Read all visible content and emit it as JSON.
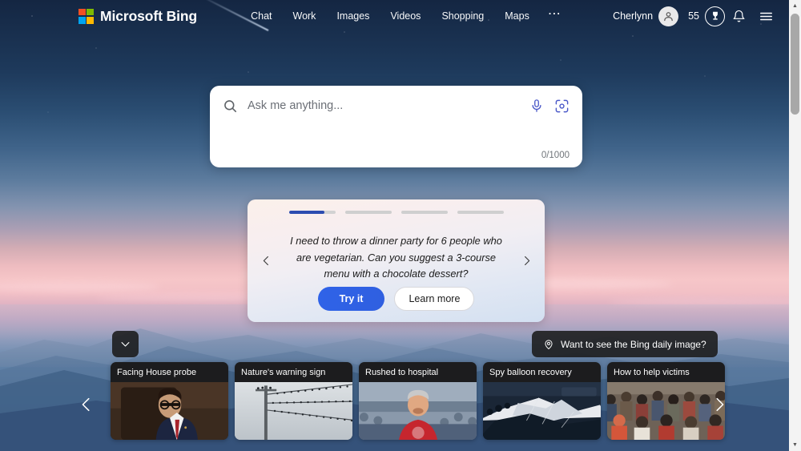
{
  "header": {
    "brand": "Microsoft Bing",
    "logo_colors": {
      "tl": "#f25022",
      "tr": "#7fba00",
      "bl": "#00a4ef",
      "br": "#ffb900"
    },
    "nav": [
      {
        "label": "Chat"
      },
      {
        "label": "Work"
      },
      {
        "label": "Images"
      },
      {
        "label": "Videos"
      },
      {
        "label": "Shopping"
      },
      {
        "label": "Maps"
      }
    ],
    "more_label": "⋯",
    "user_name": "Cherlynn",
    "rewards_points": "55",
    "icons": {
      "avatar": "person-icon",
      "rewards": "rewards-badge-icon",
      "notifications": "bell-icon",
      "menu": "hamburger-menu-icon"
    }
  },
  "search": {
    "placeholder": "Ask me anything...",
    "value": "",
    "counter": "0/1000",
    "icons": {
      "search": "search-icon",
      "mic": "microphone-icon",
      "visual": "visual-search-icon"
    },
    "accent": "#4a58c8"
  },
  "suggestion": {
    "progress_total": 4,
    "progress_active_index": 0,
    "progress_active_fill_pct": 76,
    "text": "I need to throw a dinner party for 6 people who are vegetarian. Can you suggest a 3-course menu with a chocolate dessert?",
    "try_label": "Try it",
    "learn_label": "Learn more",
    "prev_icon": "chevron-left-icon",
    "next_icon": "chevron-right-icon",
    "accent": "#2c4cb0"
  },
  "bottom": {
    "collapse_icon": "chevron-down-icon",
    "daily_image_label": "Want to see the Bing daily image?",
    "daily_image_icon": "location-pin-icon",
    "carousel_prev_icon": "chevron-left-icon",
    "carousel_next_icon": "chevron-right-icon"
  },
  "news_cards": [
    {
      "title": "Facing House probe",
      "image": "politician-seated-at-hearing"
    },
    {
      "title": "Nature's warning sign",
      "image": "birds-on-power-lines"
    },
    {
      "title": "Rushed to hospital",
      "image": "man-in-red-shirt-at-stadium"
    },
    {
      "title": "Spy balloon recovery",
      "image": "debris-recovery-at-sea"
    },
    {
      "title": "How to help victims",
      "image": "crowd-of-people-aid"
    }
  ],
  "scrollbar": {
    "up_icon": "scroll-up-icon",
    "down_icon": "scroll-down-icon"
  }
}
